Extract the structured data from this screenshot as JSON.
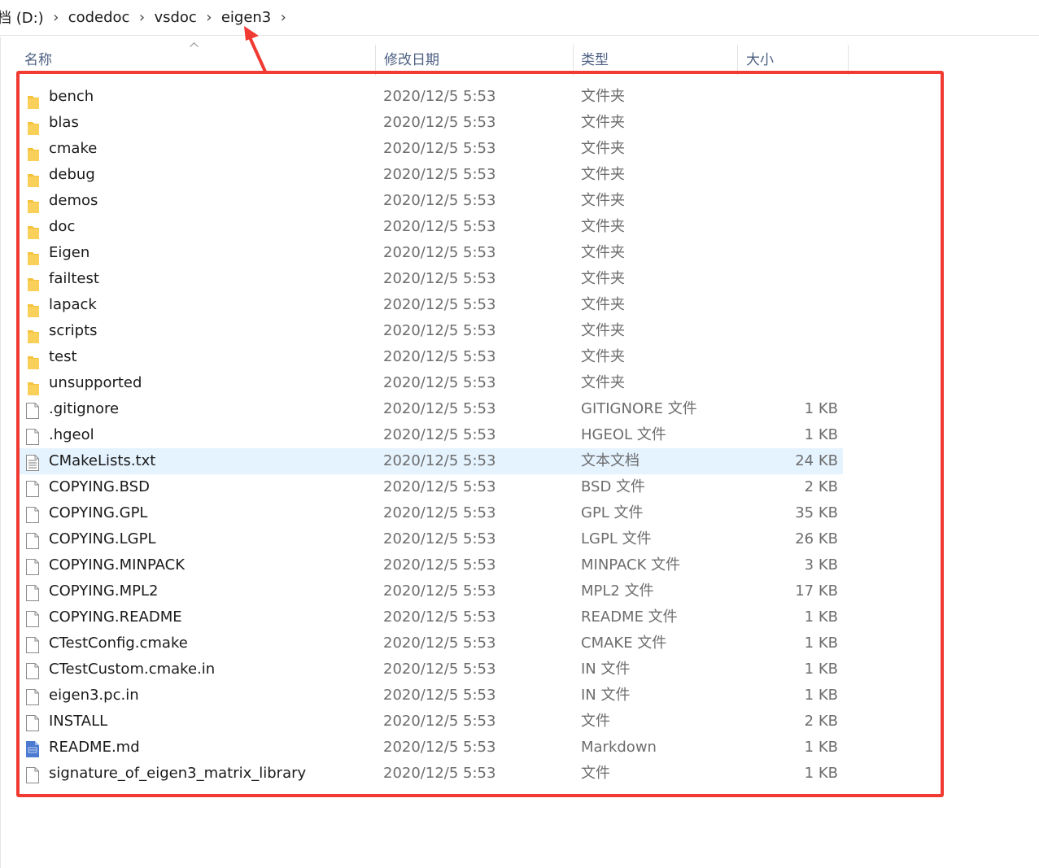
{
  "breadcrumb": {
    "items": [
      "档 (D:)",
      "codedoc",
      "vsdoc",
      "eigen3"
    ],
    "separator_icon": "chevron-right-icon"
  },
  "columns": {
    "name": "名称",
    "date": "修改日期",
    "type": "类型",
    "size": "大小"
  },
  "files": [
    {
      "name": "bench",
      "date": "2020/12/5 5:53",
      "type": "文件夹",
      "size": "",
      "icon": "folder-icon"
    },
    {
      "name": "blas",
      "date": "2020/12/5 5:53",
      "type": "文件夹",
      "size": "",
      "icon": "folder-icon"
    },
    {
      "name": "cmake",
      "date": "2020/12/5 5:53",
      "type": "文件夹",
      "size": "",
      "icon": "folder-icon"
    },
    {
      "name": "debug",
      "date": "2020/12/5 5:53",
      "type": "文件夹",
      "size": "",
      "icon": "folder-icon"
    },
    {
      "name": "demos",
      "date": "2020/12/5 5:53",
      "type": "文件夹",
      "size": "",
      "icon": "folder-icon"
    },
    {
      "name": "doc",
      "date": "2020/12/5 5:53",
      "type": "文件夹",
      "size": "",
      "icon": "folder-icon"
    },
    {
      "name": "Eigen",
      "date": "2020/12/5 5:53",
      "type": "文件夹",
      "size": "",
      "icon": "folder-icon"
    },
    {
      "name": "failtest",
      "date": "2020/12/5 5:53",
      "type": "文件夹",
      "size": "",
      "icon": "folder-icon"
    },
    {
      "name": "lapack",
      "date": "2020/12/5 5:53",
      "type": "文件夹",
      "size": "",
      "icon": "folder-icon"
    },
    {
      "name": "scripts",
      "date": "2020/12/5 5:53",
      "type": "文件夹",
      "size": "",
      "icon": "folder-icon"
    },
    {
      "name": "test",
      "date": "2020/12/5 5:53",
      "type": "文件夹",
      "size": "",
      "icon": "folder-icon"
    },
    {
      "name": "unsupported",
      "date": "2020/12/5 5:53",
      "type": "文件夹",
      "size": "",
      "icon": "folder-icon"
    },
    {
      "name": ".gitignore",
      "date": "2020/12/5 5:53",
      "type": "GITIGNORE 文件",
      "size": "1 KB",
      "icon": "file-icon"
    },
    {
      "name": ".hgeol",
      "date": "2020/12/5 5:53",
      "type": "HGEOL 文件",
      "size": "1 KB",
      "icon": "file-icon"
    },
    {
      "name": "CMakeLists.txt",
      "date": "2020/12/5 5:53",
      "type": "文本文档",
      "size": "24 KB",
      "icon": "text-file-icon",
      "selected": true
    },
    {
      "name": "COPYING.BSD",
      "date": "2020/12/5 5:53",
      "type": "BSD 文件",
      "size": "2 KB",
      "icon": "file-icon"
    },
    {
      "name": "COPYING.GPL",
      "date": "2020/12/5 5:53",
      "type": "GPL 文件",
      "size": "35 KB",
      "icon": "file-icon"
    },
    {
      "name": "COPYING.LGPL",
      "date": "2020/12/5 5:53",
      "type": "LGPL 文件",
      "size": "26 KB",
      "icon": "file-icon"
    },
    {
      "name": "COPYING.MINPACK",
      "date": "2020/12/5 5:53",
      "type": "MINPACK 文件",
      "size": "3 KB",
      "icon": "file-icon"
    },
    {
      "name": "COPYING.MPL2",
      "date": "2020/12/5 5:53",
      "type": "MPL2 文件",
      "size": "17 KB",
      "icon": "file-icon"
    },
    {
      "name": "COPYING.README",
      "date": "2020/12/5 5:53",
      "type": "README 文件",
      "size": "1 KB",
      "icon": "file-icon"
    },
    {
      "name": "CTestConfig.cmake",
      "date": "2020/12/5 5:53",
      "type": "CMAKE 文件",
      "size": "1 KB",
      "icon": "file-icon"
    },
    {
      "name": "CTestCustom.cmake.in",
      "date": "2020/12/5 5:53",
      "type": "IN 文件",
      "size": "1 KB",
      "icon": "file-icon"
    },
    {
      "name": "eigen3.pc.in",
      "date": "2020/12/5 5:53",
      "type": "IN 文件",
      "size": "1 KB",
      "icon": "file-icon"
    },
    {
      "name": "INSTALL",
      "date": "2020/12/5 5:53",
      "type": "文件",
      "size": "2 KB",
      "icon": "file-icon"
    },
    {
      "name": "README.md",
      "date": "2020/12/5 5:53",
      "type": "Markdown",
      "size": "1 KB",
      "icon": "markdown-file-icon"
    },
    {
      "name": "signature_of_eigen3_matrix_library",
      "date": "2020/12/5 5:53",
      "type": "文件",
      "size": "1 KB",
      "icon": "file-icon"
    }
  ],
  "colors": {
    "annotation": "#f03a32",
    "selection": "#e5f3ff",
    "folder": "#f5c23b",
    "header_text": "#4d6082"
  }
}
